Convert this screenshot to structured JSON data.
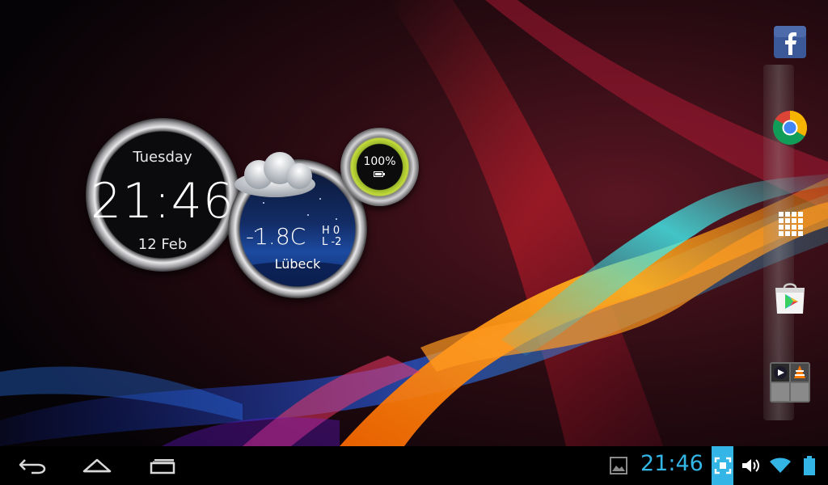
{
  "clock": {
    "day": "Tuesday",
    "time": "21:46",
    "date": "12 Feb"
  },
  "weather": {
    "temp": "-1.8C",
    "high": "H 0",
    "low": "L -2",
    "city": "Lübeck",
    "condition_icon": "cloud-icon"
  },
  "battery_widget": {
    "percent": "100%",
    "ring_color": "#c4dc3a"
  },
  "dock": {
    "apps": [
      "facebook-icon",
      "chrome-icon",
      "app-drawer-icon",
      "play-store-icon",
      "folder-icon"
    ]
  },
  "navigation": {
    "buttons": [
      "back-icon",
      "home-icon",
      "recent-apps-icon"
    ]
  },
  "status_bar": {
    "time": "21:46",
    "accent": "#33b5e5",
    "icons": [
      "gallery-icon",
      "screenshot-icon",
      "volume-icon",
      "wifi-icon",
      "battery-icon"
    ]
  }
}
